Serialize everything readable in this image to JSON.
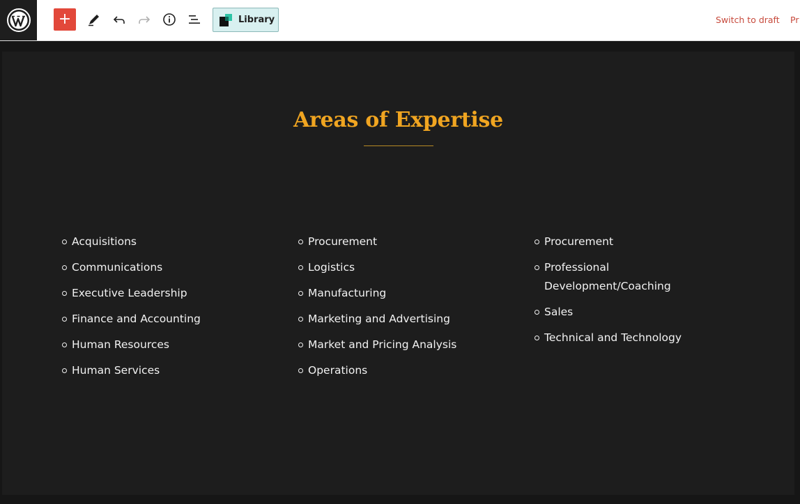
{
  "toolbar": {
    "add_label": "+",
    "library_label": "Library",
    "switch_to_draft": "Switch to draft",
    "preview_truncated": "Pr"
  },
  "icons": {
    "logo": "wordpress-logo-icon",
    "add": "plus-icon",
    "tools": "pencil-icon",
    "undo": "undo-icon",
    "redo": "redo-icon",
    "details": "info-icon",
    "outline": "list-view-icon",
    "library": "library-logo-icon"
  },
  "colors": {
    "accent_gold": "#f0a521",
    "add_button": "#e2483a",
    "link_red": "#c74a3c",
    "canvas_bg": "#1d1d1d"
  },
  "content": {
    "heading": "Areas of Expertise",
    "columns": [
      {
        "items": [
          "Acquisitions",
          "Communications",
          "Executive Leadership",
          "Finance and Accounting",
          "Human Resources",
          "Human Services"
        ]
      },
      {
        "items": [
          "Procurement",
          "Logistics",
          "Manufacturing",
          "Marketing and Advertising",
          "Market and Pricing Analysis",
          "Operations"
        ]
      },
      {
        "items": [
          "Procurement",
          "Professional Development/Coaching",
          "Sales",
          "Technical and Technology"
        ]
      }
    ]
  }
}
